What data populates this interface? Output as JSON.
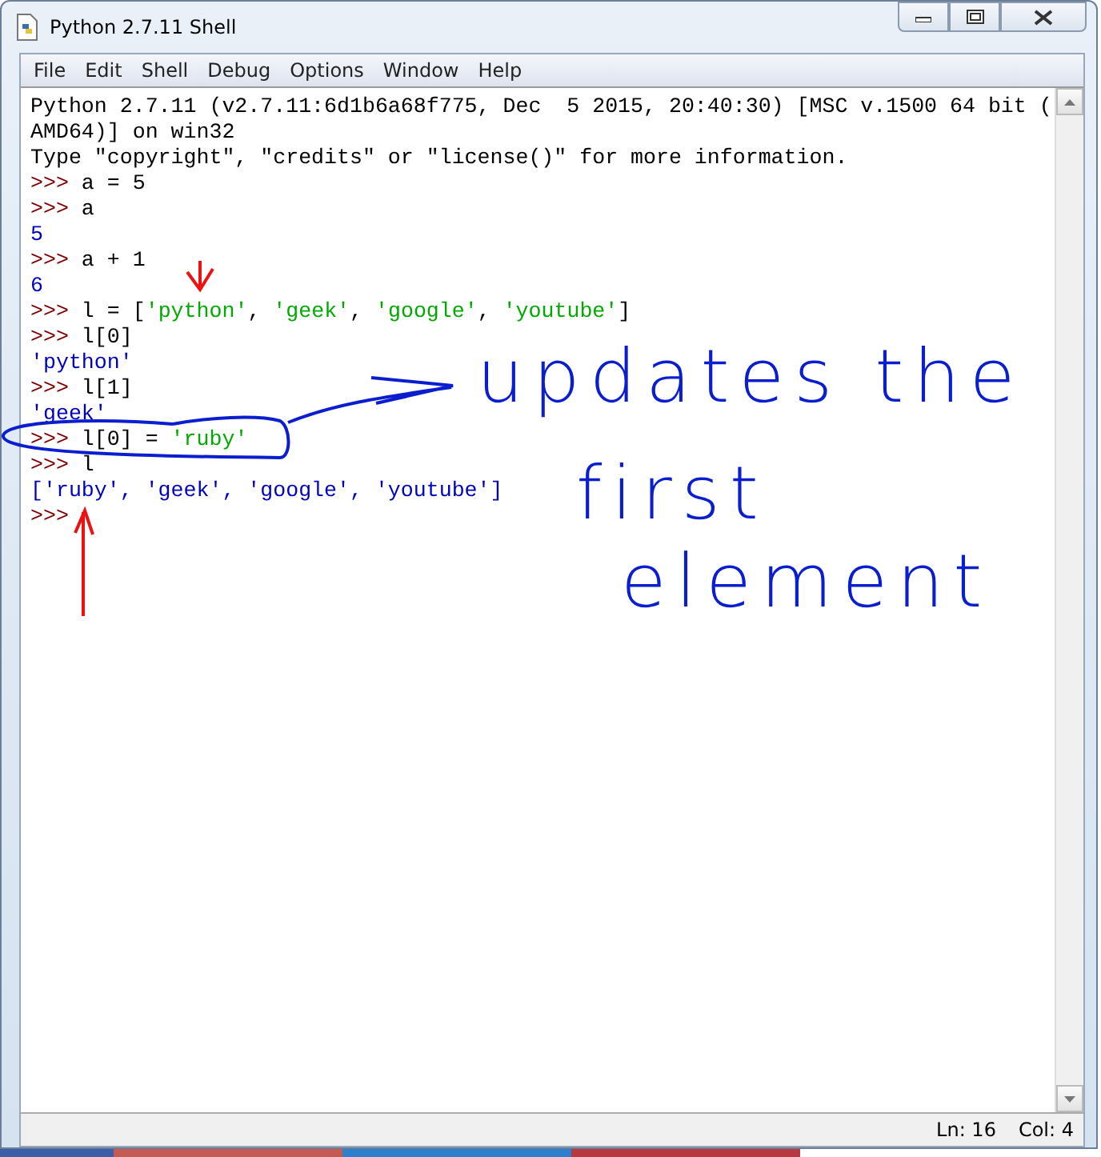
{
  "window": {
    "title": "Python 2.7.11 Shell"
  },
  "menu": [
    "File",
    "Edit",
    "Shell",
    "Debug",
    "Options",
    "Window",
    "Help"
  ],
  "shell_lines": [
    [
      {
        "kind": "banner",
        "text": "Python 2.7.11 (v2.7.11:6d1b6a68f775, Dec  5 2015, 20:40:30) [MSC v.1500 64 bit ("
      }
    ],
    [
      {
        "kind": "banner",
        "text": "AMD64)] on win32"
      }
    ],
    [
      {
        "kind": "banner",
        "text": "Type \"copyright\", \"credits\" or \"license()\" for more information."
      }
    ],
    [
      {
        "kind": "prompt",
        "text": ">>>"
      },
      {
        "kind": "input",
        "text": " a = 5"
      }
    ],
    [
      {
        "kind": "prompt",
        "text": ">>>"
      },
      {
        "kind": "input",
        "text": " a"
      }
    ],
    [
      {
        "kind": "output",
        "text": "5"
      }
    ],
    [
      {
        "kind": "prompt",
        "text": ">>>"
      },
      {
        "kind": "input",
        "text": " a + 1"
      }
    ],
    [
      {
        "kind": "output",
        "text": "6"
      }
    ],
    [
      {
        "kind": "prompt",
        "text": ">>>"
      },
      {
        "kind": "input",
        "text": " l = ["
      },
      {
        "kind": "string",
        "text": "'python'"
      },
      {
        "kind": "input",
        "text": ", "
      },
      {
        "kind": "string",
        "text": "'geek'"
      },
      {
        "kind": "input",
        "text": ", "
      },
      {
        "kind": "string",
        "text": "'google'"
      },
      {
        "kind": "input",
        "text": ", "
      },
      {
        "kind": "string",
        "text": "'youtube'"
      },
      {
        "kind": "input",
        "text": "]"
      }
    ],
    [
      {
        "kind": "prompt",
        "text": ">>>"
      },
      {
        "kind": "input",
        "text": " l[0]"
      }
    ],
    [
      {
        "kind": "output",
        "text": "'python'"
      }
    ],
    [
      {
        "kind": "prompt",
        "text": ">>>"
      },
      {
        "kind": "input",
        "text": " l[1]"
      }
    ],
    [
      {
        "kind": "output",
        "text": "'geek'"
      }
    ],
    [
      {
        "kind": "prompt",
        "text": ">>>"
      },
      {
        "kind": "input",
        "text": " l[0] = "
      },
      {
        "kind": "string",
        "text": "'ruby'"
      }
    ],
    [
      {
        "kind": "prompt",
        "text": ">>>"
      },
      {
        "kind": "input",
        "text": " l"
      }
    ],
    [
      {
        "kind": "output",
        "text": "['ruby', 'geek', 'google', 'youtube']"
      }
    ],
    [
      {
        "kind": "prompt",
        "text": ">>>"
      }
    ]
  ],
  "annotation": [
    "updates the",
    "first",
    "element"
  ],
  "status_bar": [
    "Ln: 16",
    "Col: 4"
  ]
}
